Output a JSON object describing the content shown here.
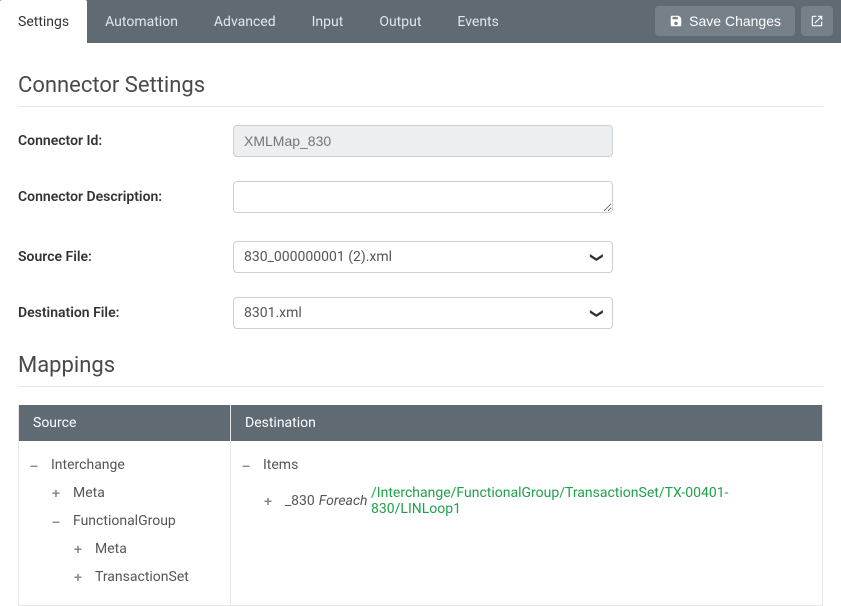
{
  "tabs": [
    "Settings",
    "Automation",
    "Advanced",
    "Input",
    "Output",
    "Events"
  ],
  "activeTab": 0,
  "buttons": {
    "save": "Save Changes"
  },
  "sections": {
    "connector": "Connector Settings",
    "mappings": "Mappings"
  },
  "form": {
    "connectorIdLabel": "Connector Id:",
    "connectorIdValue": "XMLMap_830",
    "descLabel": "Connector Description:",
    "descValue": "",
    "sourceLabel": "Source File:",
    "sourceValue": "830_000000001 (2).xml",
    "destLabel": "Destination File:",
    "destValue": "8301.xml"
  },
  "mapHeaders": {
    "source": "Source",
    "dest": "Destination"
  },
  "sourceTree": [
    {
      "icon": "–",
      "label": "Interchange",
      "indent": 0
    },
    {
      "icon": "+",
      "label": "Meta",
      "indent": 1
    },
    {
      "icon": "–",
      "label": "FunctionalGroup",
      "indent": 1
    },
    {
      "icon": "+",
      "label": "Meta",
      "indent": 2
    },
    {
      "icon": "+",
      "label": "TransactionSet",
      "indent": 2
    }
  ],
  "destTree": {
    "row1": {
      "icon": "–",
      "label": "Items"
    },
    "row2": {
      "icon": "+",
      "label": "_830",
      "verb": "Foreach",
      "path": "/Interchange/FunctionalGroup/TransactionSet/TX-00401-830/LINLoop1"
    }
  }
}
